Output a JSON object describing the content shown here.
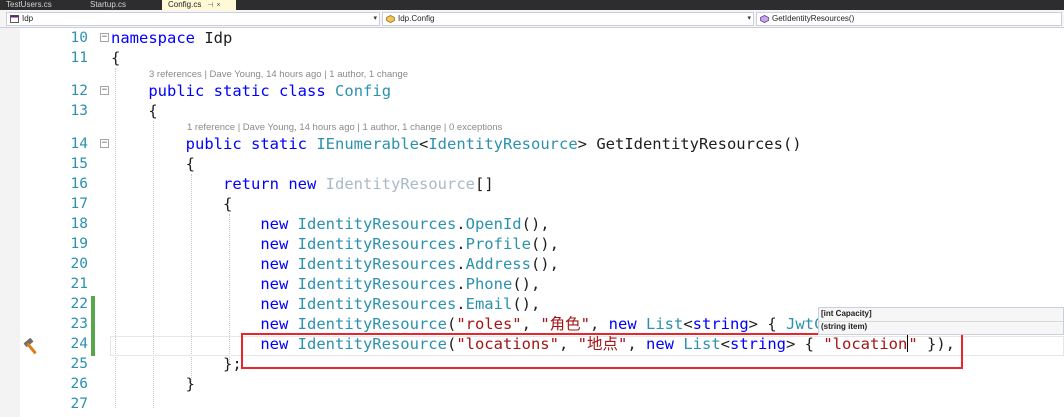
{
  "tabs": [
    {
      "label": "TestUsers.cs",
      "active": false
    },
    {
      "label": "Startup.cs",
      "active": false
    },
    {
      "label": "Config.cs",
      "active": true,
      "pin_glyph": "⊣",
      "close_glyph": "×"
    }
  ],
  "navbar": {
    "project": "Idp",
    "type": "Idp.Config",
    "member": "GetIdentityResources()"
  },
  "codelens": {
    "class": "3 references | Dave Young, 14 hours ago | 1 author, 1 change",
    "method": "1 reference | Dave Young, 14 hours ago | 1 author, 1 change | 0 exceptions"
  },
  "lines": [
    {
      "n": "10",
      "fold": "−",
      "tokens": [
        [
          "kw",
          "namespace"
        ],
        [
          "",
          " Idp"
        ]
      ]
    },
    {
      "n": "11",
      "fold": "",
      "tokens": [
        [
          "",
          "{"
        ]
      ]
    },
    {
      "n": "12",
      "fold": "−",
      "tokens": [
        [
          "",
          "    "
        ],
        [
          "kw",
          "public"
        ],
        [
          "",
          " "
        ],
        [
          "kw",
          "static"
        ],
        [
          "",
          " "
        ],
        [
          "kw",
          "class"
        ],
        [
          "",
          " "
        ],
        [
          "ty",
          "Config"
        ]
      ]
    },
    {
      "n": "13",
      "fold": "",
      "tokens": [
        [
          "",
          "    {"
        ]
      ]
    },
    {
      "n": "14",
      "fold": "−",
      "tokens": [
        [
          "",
          "        "
        ],
        [
          "kw",
          "public"
        ],
        [
          "",
          " "
        ],
        [
          "kw",
          "static"
        ],
        [
          "",
          " "
        ],
        [
          "ty",
          "IEnumerable"
        ],
        [
          "",
          "<"
        ],
        [
          "ty",
          "IdentityResource"
        ],
        [
          "",
          "> GetIdentityResources()"
        ]
      ]
    },
    {
      "n": "15",
      "fold": "",
      "tokens": [
        [
          "",
          "        {"
        ]
      ]
    },
    {
      "n": "16",
      "fold": "",
      "tokens": [
        [
          "",
          "            "
        ],
        [
          "kw",
          "return"
        ],
        [
          "",
          " "
        ],
        [
          "kw",
          "new"
        ],
        [
          "",
          " "
        ],
        [
          "dim",
          "IdentityResource"
        ],
        [
          "",
          "[]"
        ]
      ]
    },
    {
      "n": "17",
      "fold": "",
      "tokens": [
        [
          "",
          "            {"
        ]
      ]
    },
    {
      "n": "18",
      "fold": "",
      "tokens": [
        [
          "",
          "                "
        ],
        [
          "kw",
          "new"
        ],
        [
          "",
          " "
        ],
        [
          "ty",
          "IdentityResources"
        ],
        [
          "",
          "."
        ],
        [
          "ty",
          "OpenId"
        ],
        [
          "",
          "(),"
        ]
      ]
    },
    {
      "n": "19",
      "fold": "",
      "tokens": [
        [
          "",
          "                "
        ],
        [
          "kw",
          "new"
        ],
        [
          "",
          " "
        ],
        [
          "ty",
          "IdentityResources"
        ],
        [
          "",
          "."
        ],
        [
          "ty",
          "Profile"
        ],
        [
          "",
          "(),"
        ]
      ]
    },
    {
      "n": "20",
      "fold": "",
      "tokens": [
        [
          "",
          "                "
        ],
        [
          "kw",
          "new"
        ],
        [
          "",
          " "
        ],
        [
          "ty",
          "IdentityResources"
        ],
        [
          "",
          "."
        ],
        [
          "ty",
          "Address"
        ],
        [
          "",
          "(),"
        ]
      ]
    },
    {
      "n": "21",
      "fold": "",
      "tokens": [
        [
          "",
          "                "
        ],
        [
          "kw",
          "new"
        ],
        [
          "",
          " "
        ],
        [
          "ty",
          "IdentityResources"
        ],
        [
          "",
          "."
        ],
        [
          "ty",
          "Phone"
        ],
        [
          "",
          "(),"
        ]
      ]
    },
    {
      "n": "22",
      "fold": "",
      "tokens": [
        [
          "",
          "                "
        ],
        [
          "kw",
          "new"
        ],
        [
          "",
          " "
        ],
        [
          "ty",
          "IdentityResources"
        ],
        [
          "",
          "."
        ],
        [
          "ty",
          "Email"
        ],
        [
          "",
          "(),"
        ]
      ]
    },
    {
      "n": "23",
      "fold": "",
      "tokens": [
        [
          "",
          "                "
        ],
        [
          "kw",
          "new"
        ],
        [
          "",
          " "
        ],
        [
          "ty",
          "IdentityResource"
        ],
        [
          "",
          "("
        ],
        [
          "st",
          "\"roles\""
        ],
        [
          "",
          ", "
        ],
        [
          "st",
          "\"角色\""
        ],
        [
          "",
          ", "
        ],
        [
          "kw",
          "new"
        ],
        [
          "",
          " "
        ],
        [
          "ty",
          "List"
        ],
        [
          "",
          "<"
        ],
        [
          "kw",
          "string"
        ],
        [
          "",
          "> { "
        ],
        [
          "ty",
          "JwtC"
        ]
      ]
    },
    {
      "n": "24",
      "fold": "",
      "tokens": [
        [
          "",
          "                "
        ],
        [
          "kw",
          "new"
        ],
        [
          "",
          " "
        ],
        [
          "ty",
          "IdentityResource"
        ],
        [
          "",
          "("
        ],
        [
          "st",
          "\"locations\""
        ],
        [
          "",
          ", "
        ],
        [
          "st",
          "\"地点\""
        ],
        [
          "",
          ", "
        ],
        [
          "kw",
          "new"
        ],
        [
          "",
          " "
        ],
        [
          "ty",
          "List"
        ],
        [
          "",
          "<"
        ],
        [
          "kw",
          "string"
        ],
        [
          "",
          "> { "
        ],
        [
          "st",
          "\"location"
        ],
        [
          "caret",
          ""
        ],
        [
          "st",
          "\""
        ],
        [
          "",
          " }),"
        ]
      ]
    },
    {
      "n": "25",
      "fold": "",
      "tokens": [
        [
          "",
          "            };"
        ]
      ]
    },
    {
      "n": "26",
      "fold": "",
      "tokens": [
        [
          "",
          "        }"
        ]
      ]
    },
    {
      "n": "27",
      "fold": "",
      "tokens": [
        [
          "",
          ""
        ]
      ]
    }
  ],
  "tooltip": {
    "line1": "[int Capacity]",
    "line2": "(string item)"
  },
  "colors": {
    "keyword": "#0000ff",
    "type": "#2b91af",
    "string": "#a31515",
    "highlight_box": "#e8262e",
    "change_bar": "#57a64a"
  },
  "icons": {
    "quick_action": "hammer-icon",
    "project_nav": "csharp-project-icon",
    "type_nav": "class-icon",
    "member_nav": "method-icon"
  }
}
